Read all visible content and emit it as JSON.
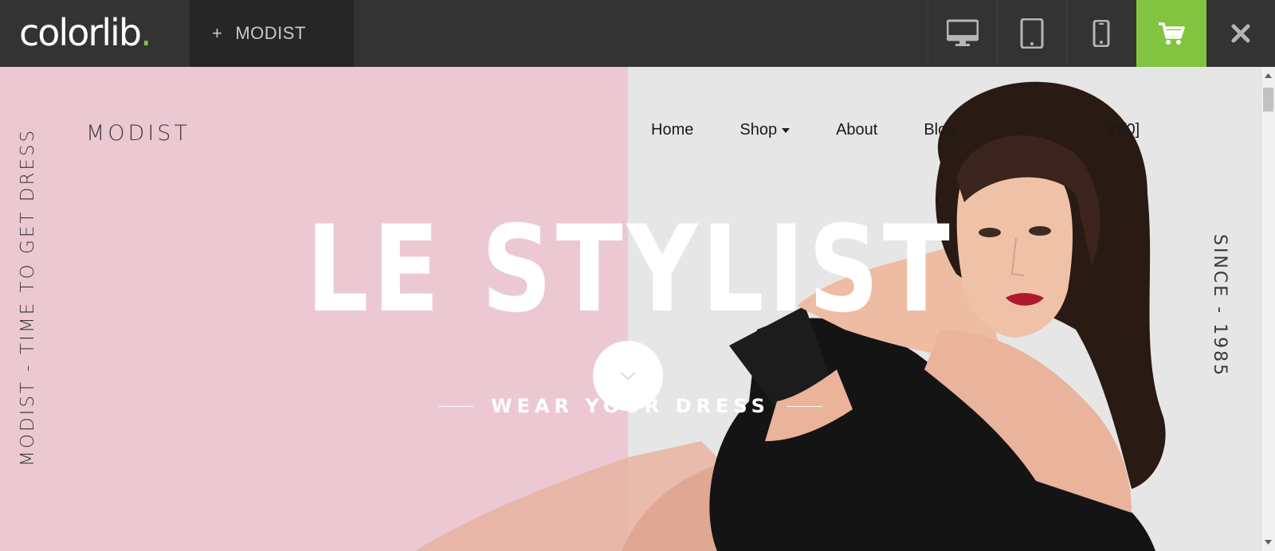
{
  "topbar": {
    "brand_name": "colorlib",
    "brand_dot": ".",
    "theme_tab_plus": "+",
    "theme_tab_label": "MODIST",
    "accent_color": "#82c43f",
    "icons": [
      "desktop-icon",
      "tablet-icon",
      "mobile-icon",
      "cart-icon",
      "close-icon"
    ]
  },
  "site": {
    "logo": "MODIST",
    "nav": [
      {
        "label": "Home"
      },
      {
        "label": "Shop"
      },
      {
        "label": "About"
      },
      {
        "label": "Blog"
      }
    ],
    "cart_count": "[0]",
    "side_left_text": "MODIST - TIME TO GET DRESS",
    "side_right_text": "SINCE - 1985",
    "hero_title": "LE STYLIST",
    "tagline": "WEAR YOUR DRESS",
    "colors": {
      "pink_panel": "#ecc9d2",
      "grey_panel": "#e6e6e6"
    }
  }
}
